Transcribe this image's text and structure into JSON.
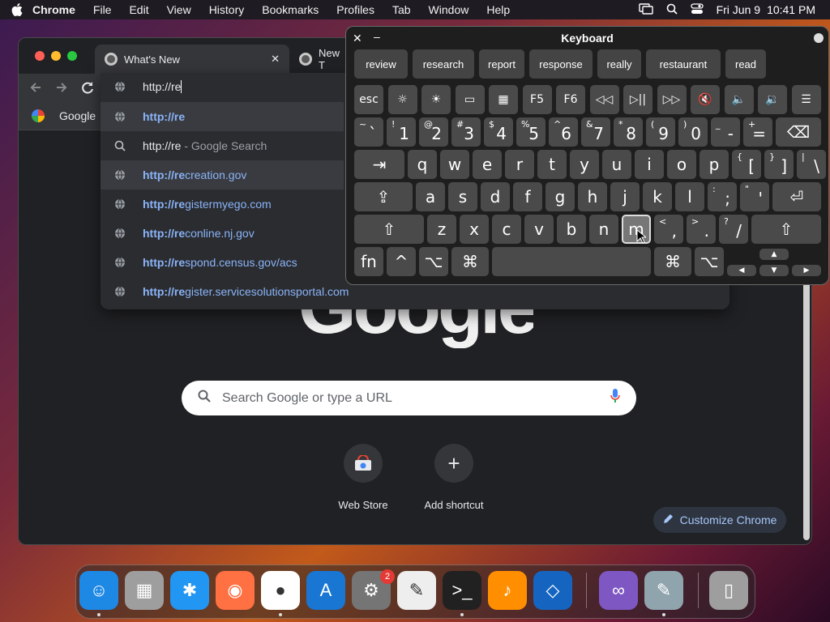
{
  "menubar": {
    "app": "Chrome",
    "items": [
      "File",
      "Edit",
      "View",
      "History",
      "Bookmarks",
      "Profiles",
      "Tab",
      "Window",
      "Help"
    ],
    "date": "Fri Jun 9",
    "time": "10:41 PM"
  },
  "tabs": [
    {
      "title": "What's New",
      "close": "✕"
    },
    {
      "title": "New T"
    }
  ],
  "bookmark": "Google",
  "omnibox": {
    "value": "http://re",
    "suggestions": [
      {
        "bold": "http://re",
        "rest": "",
        "icon": "globe-icon"
      },
      {
        "bold": "",
        "rest": "http://re",
        "suffix": " - Google Search",
        "icon": "search-icon"
      },
      {
        "bold": "http://re",
        "rest": "creation.gov",
        "icon": "globe-icon"
      },
      {
        "bold": "http://re",
        "rest": "gistermyego.com",
        "icon": "globe-icon"
      },
      {
        "bold": "http://re",
        "rest": "conline.nj.gov",
        "icon": "globe-icon"
      },
      {
        "bold": "http://re",
        "rest": "spond.census.gov/acs",
        "icon": "globe-icon"
      },
      {
        "bold": "http://re",
        "rest": "gister.servicesolutionsportal.com",
        "icon": "globe-icon"
      }
    ]
  },
  "google": {
    "logo": "Google",
    "search_placeholder": "Search Google or type a URL",
    "shortcuts": [
      "Web Store",
      "Add shortcut"
    ],
    "customize": "Customize Chrome"
  },
  "keyboard": {
    "title": "Keyboard",
    "predictions": [
      "review",
      "research",
      "report",
      "response",
      "really",
      "restaurant",
      "read"
    ],
    "fkeys": [
      "esc",
      "☼",
      "☀",
      "▭",
      "▦",
      "F5",
      "F6",
      "◁◁",
      "▷||",
      "▷▷",
      "🔇",
      "🔈",
      "🔉",
      "☰"
    ],
    "row1": [
      [
        "~",
        "`"
      ],
      [
        "!",
        "1"
      ],
      [
        "@",
        "2"
      ],
      [
        "#",
        "3"
      ],
      [
        "$",
        "4"
      ],
      [
        "%",
        "5"
      ],
      [
        "^",
        "6"
      ],
      [
        "&",
        "7"
      ],
      [
        "*",
        "8"
      ],
      [
        "(",
        "9"
      ],
      [
        ")",
        "0"
      ],
      [
        "_",
        "-"
      ],
      [
        "+",
        "="
      ]
    ],
    "row2": [
      "q",
      "w",
      "e",
      "r",
      "t",
      "y",
      "u",
      "i",
      "o",
      "p"
    ],
    "row2b": [
      [
        "{",
        "["
      ],
      [
        "}",
        "]"
      ],
      [
        "|",
        "\\"
      ]
    ],
    "row3": [
      "a",
      "s",
      "d",
      "f",
      "g",
      "h",
      "j",
      "k",
      "l"
    ],
    "row3b": [
      [
        ":",
        ";"
      ],
      [
        "\"",
        "'"
      ]
    ],
    "row4": [
      "z",
      "x",
      "c",
      "v",
      "b",
      "n",
      "m"
    ],
    "row4b": [
      [
        "<",
        ","
      ],
      [
        ">",
        "."
      ],
      [
        "?",
        "/"
      ]
    ],
    "mods": {
      "fn": "fn",
      "ctrl": "^",
      "opt": "⌥",
      "cmd": "⌘",
      "tab": "⇥",
      "caps": "⇪",
      "shift": "⇧",
      "delete": "⌫",
      "return": "⏎",
      "up": "▲",
      "down": "▼",
      "left": "◀",
      "right": "▶"
    }
  },
  "dock": {
    "badge": "2"
  }
}
